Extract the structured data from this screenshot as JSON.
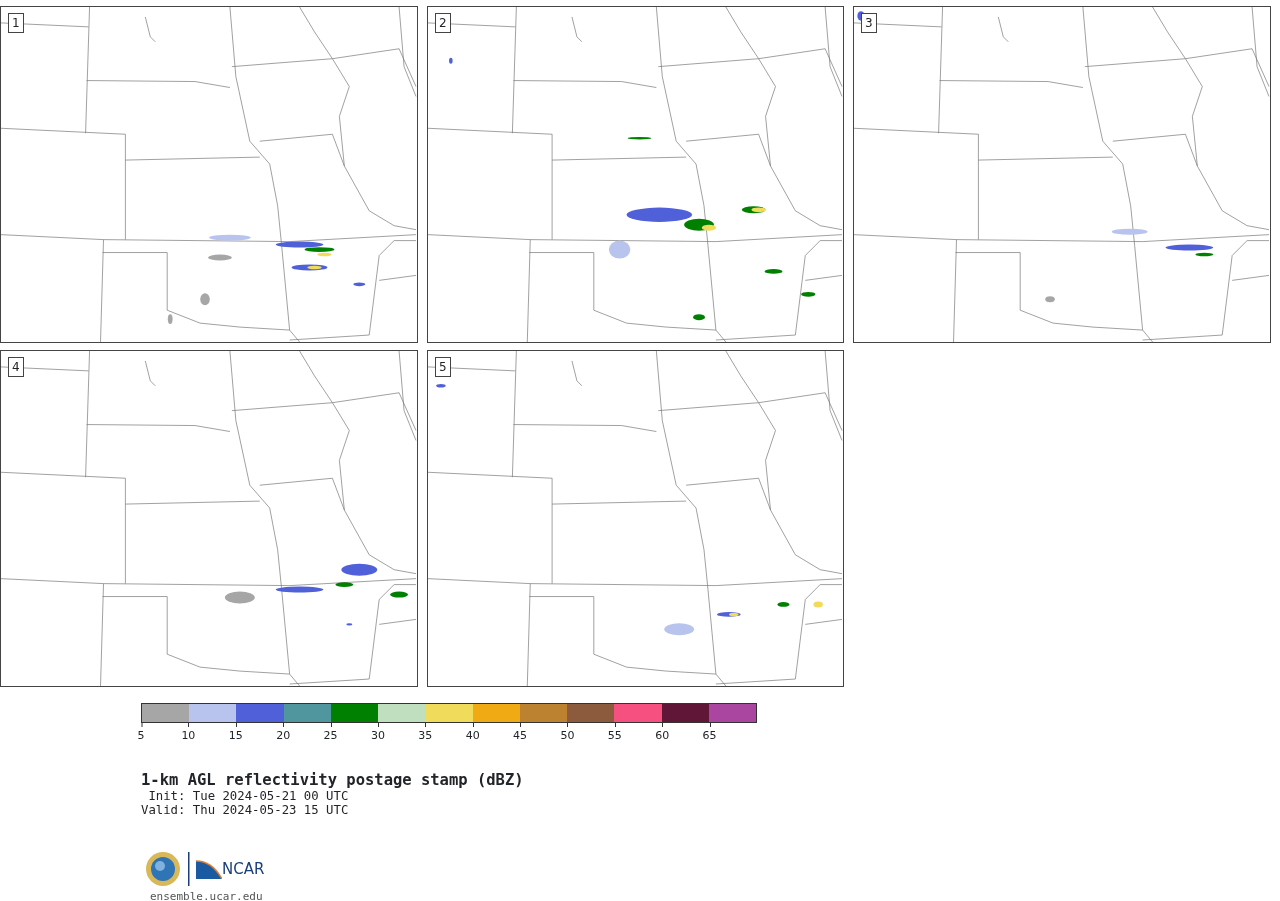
{
  "panels": [
    {
      "label": "1"
    },
    {
      "label": "2"
    },
    {
      "label": "3"
    },
    {
      "label": "4"
    },
    {
      "label": "5"
    }
  ],
  "colorbar": {
    "bins": [
      {
        "color": "#a6a6a6"
      },
      {
        "color": "#b8c3ee"
      },
      {
        "color": "#5060d8"
      },
      {
        "color": "#50969e"
      },
      {
        "color": "#008000"
      },
      {
        "color": "#bfdfbf"
      },
      {
        "color": "#f0dc5a"
      },
      {
        "color": "#f0aa14"
      },
      {
        "color": "#bd8230"
      },
      {
        "color": "#8c5a3c"
      },
      {
        "color": "#f5507f"
      },
      {
        "color": "#5f1637"
      },
      {
        "color": "#aa46a0"
      }
    ],
    "ticks": [
      "5",
      "10",
      "15",
      "20",
      "25",
      "30",
      "35",
      "40",
      "45",
      "50",
      "55",
      "60",
      "65"
    ]
  },
  "title": "1-km AGL reflectivity postage stamp (dBZ)",
  "init": " Init: Tue 2024-05-21 00 UTC",
  "valid": "Valid: Thu 2024-05-23 15 UTC",
  "logo_text": "NCAR",
  "site": "ensemble.ucar.edu"
}
